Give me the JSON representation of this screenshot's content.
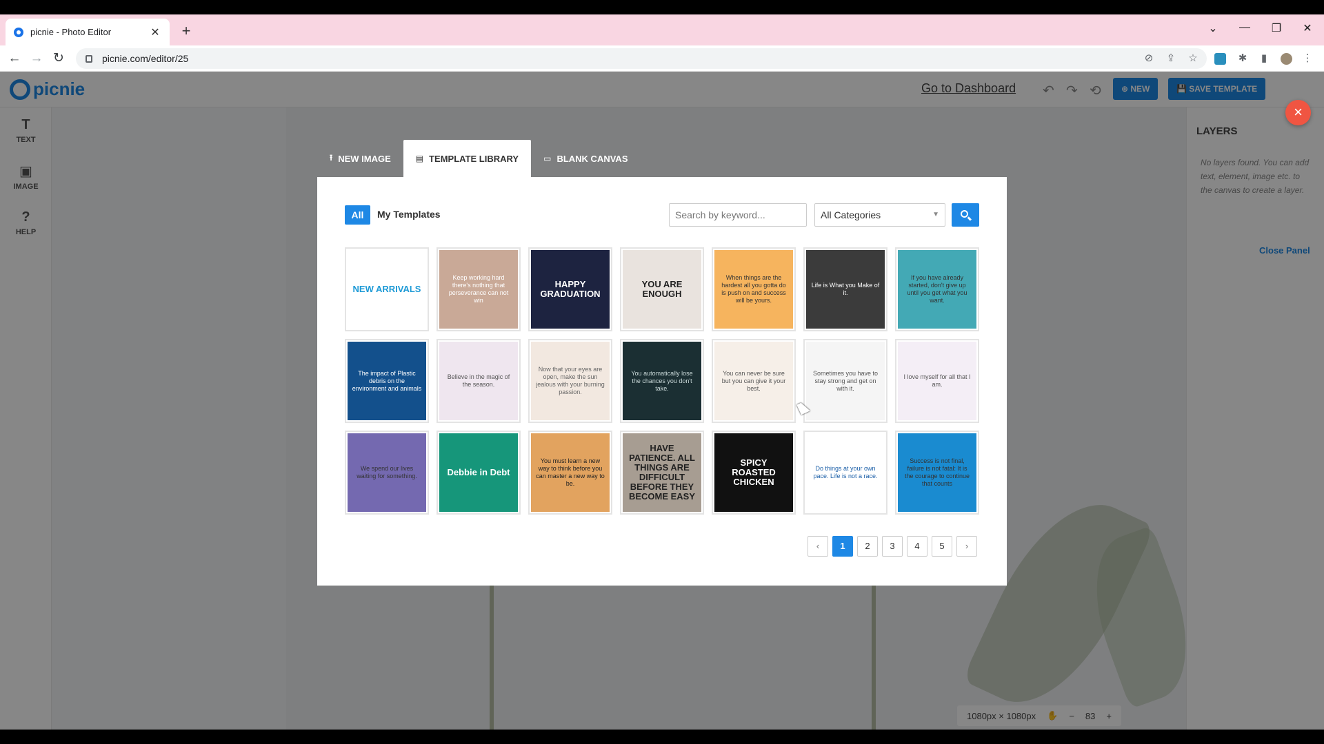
{
  "browser": {
    "tab_title": "picnie - Photo Editor",
    "tab_close": "✕",
    "new_tab": "+",
    "url": "picnie.com/editor/25",
    "controls": {
      "minimize": "—",
      "restore": "❐",
      "close": "✕",
      "tab_list": "⌄"
    }
  },
  "app": {
    "logo_text": "picnie",
    "go_dashboard": "Go to Dashboard",
    "new_button": "⊕ NEW",
    "save_template_button": "💾 SAVE TEMPLATE",
    "left_rail": [
      {
        "label": "TEXT",
        "icon": "T"
      },
      {
        "label": "IMAGE",
        "icon": "▣"
      },
      {
        "label": "HELP",
        "icon": "?"
      }
    ],
    "layers": {
      "title": "LAYERS",
      "empty_text": "No layers found. You can add text, element, image etc. to the canvas to create a layer.",
      "close_panel": "Close Panel"
    },
    "zoom": {
      "size": "1080px × 1080px",
      "minus": "−",
      "value": "83",
      "plus": "+"
    }
  },
  "modal": {
    "close_icon": "×",
    "tabs": [
      {
        "label": "NEW IMAGE",
        "icon": "⭱",
        "active": false
      },
      {
        "label": "TEMPLATE LIBRARY",
        "icon": "▤",
        "active": true
      },
      {
        "label": "BLANK CANVAS",
        "icon": "▭",
        "active": false
      }
    ],
    "filters": {
      "all": "All",
      "mine": "My Templates"
    },
    "search": {
      "placeholder": "Search by keyword..."
    },
    "category": {
      "selected": "All Categories"
    },
    "templates": [
      {
        "name": "new-arrivals",
        "bg": "#ffffff",
        "fg": "#1e9ad6",
        "text": "NEW ARRIVALS"
      },
      {
        "name": "keep-working",
        "bg": "#c9a997",
        "fg": "#ffffff",
        "text": "Keep working hard there's nothing that perseverance can not win"
      },
      {
        "name": "happy-graduation",
        "bg": "#1d2340",
        "fg": "#ffffff",
        "text": "HAPPY GRADUATION"
      },
      {
        "name": "you-are-enough",
        "bg": "#e9e3de",
        "fg": "#222222",
        "text": "YOU ARE ENOUGH"
      },
      {
        "name": "hardest-quote",
        "bg": "#f6b45e",
        "fg": "#333333",
        "text": "When things are the hardest all you gotta do is push on and success will be yours."
      },
      {
        "name": "life-is-what",
        "bg": "#3b3b3b",
        "fg": "#ffffff",
        "text": "Life is What you Make of it."
      },
      {
        "name": "dont-give-up",
        "bg": "#43a9b5",
        "fg": "#333333",
        "text": "If you have already started, don't give up until you get what you want."
      },
      {
        "name": "plastic-ocean",
        "bg": "#13508c",
        "fg": "#ffffff",
        "text": "The impact of Plastic debris on the environment and animals"
      },
      {
        "name": "daily-motivation",
        "bg": "#efe6ef",
        "fg": "#555555",
        "text": "Believe in the magic of the season."
      },
      {
        "name": "open-eyes",
        "bg": "#f2e8e0",
        "fg": "#666666",
        "text": "Now that your eyes are open, make the sun jealous with your burning passion."
      },
      {
        "name": "chances",
        "bg": "#1b2f33",
        "fg": "#c9d8d8",
        "text": "You automatically lose the chances you don't take."
      },
      {
        "name": "emily-quote",
        "bg": "#f6efe8",
        "fg": "#555555",
        "text": "You can never be sure but you can give it your best."
      },
      {
        "name": "emily-quote-2",
        "bg": "#f5f5f5",
        "fg": "#555555",
        "text": "Sometimes you have to stay strong and get on with it."
      },
      {
        "name": "floral-love",
        "bg": "#f4eef6",
        "fg": "#555555",
        "text": "I love myself for all that I am."
      },
      {
        "name": "purple-note",
        "bg": "#7469b0",
        "fg": "#333333",
        "text": "We spend our lives waiting for something."
      },
      {
        "name": "debbie-debt",
        "bg": "#16967a",
        "fg": "#ffffff",
        "text": "Debbie in Debt"
      },
      {
        "name": "learn-new-way",
        "bg": "#e2a35f",
        "fg": "#222222",
        "text": "You must learn a new way to think before you can master a new way to be."
      },
      {
        "name": "have-patience",
        "bg": "#a79d92",
        "fg": "#222222",
        "text": "HAVE PATIENCE. ALL THINGS ARE DIFFICULT BEFORE THEY BECOME EASY"
      },
      {
        "name": "spicy-chicken",
        "bg": "#111111",
        "fg": "#ffffff",
        "text": "SPICY ROASTED CHICKEN"
      },
      {
        "name": "own-pace",
        "bg": "#ffffff",
        "fg": "#1b5fa8",
        "text": "Do things at your own pace. Life is not a race."
      },
      {
        "name": "success-final",
        "bg": "#1a8bd0",
        "fg": "#333333",
        "text": "Success is not final, failure is not fatal: It is the courage to continue that counts"
      }
    ],
    "pagination": {
      "prev": "‹",
      "pages": [
        "1",
        "2",
        "3",
        "4",
        "5"
      ],
      "next": "›",
      "current": "1"
    }
  }
}
